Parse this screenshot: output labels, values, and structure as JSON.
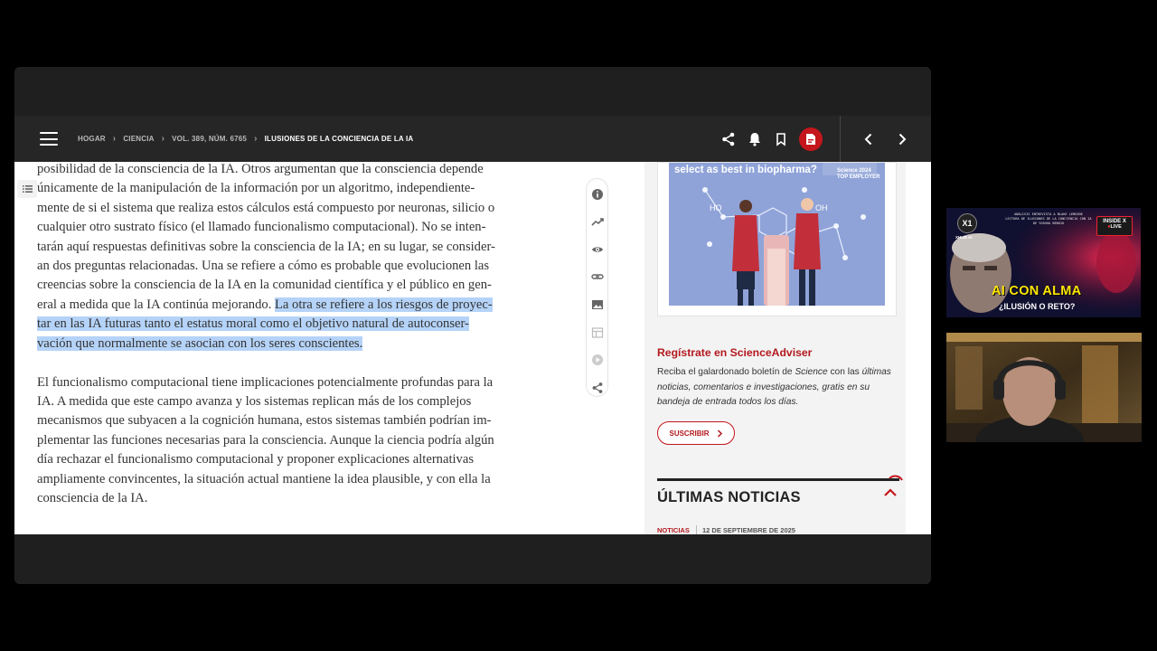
{
  "breadcrumb": {
    "items": [
      "HOGAR",
      "CIENCIA",
      "VOL. 389, NÚM. 6765"
    ],
    "current": "ILUSIONES DE LA CONCIENCIA DE LA IA"
  },
  "header_icons": [
    "share-icon",
    "bell-icon",
    "bookmark-icon",
    "pdf-icon",
    "chevron-left-icon",
    "chevron-right-icon"
  ],
  "article": {
    "p1_lines": [
      "posibilidad de la consciencia de la IA. Otros argumentan que la consciencia depende",
      "únicamente de la manipulación de la información por un algoritmo, independiente-",
      "mente de si el sistema que realiza estos cálculos está compuesto por neuronas, silicio o",
      "cualquier otro sustrato físico (el llamado funcionalismo computacional). No se inten-",
      "tarán aquí respuestas definitivas sobre la consciencia de la IA; en su lugar, se consider-",
      "an dos preguntas relacionadas. Una se refiere a cómo es probable que evolucionen las",
      "creencias sobre la consciencia de la IA en la comunidad científica y el público en gen-"
    ],
    "p1_line8_plain": "eral a medida que la IA continúa mejorando. ",
    "p1_line8_hl": "La otra se refiere a los riesgos de proyec-",
    "p1_hl_line9": "tar en las IA futuras tanto el estatus moral como el objetivo natural de autoconser-",
    "p1_hl_line10": "vación que normalmente se asocian con los seres conscientes.",
    "p2_lines": [
      "El funcionalismo computacional tiene implicaciones potencialmente profundas para la",
      "IA. A medida que este campo avanza y los sistemas replican más de los complejos",
      "mecanismos que subyacen a la cognición humana, estos sistemas también podrían im-",
      "plementar las funciones necesarias para la consciencia. Aunque la ciencia podría algún",
      "día rechazar el funcionalismo computacional y proponer explicaciones alternativas",
      "ampliamente convincentes, la situación actual mantiene la idea plausible, y con ella la",
      "consciencia de la IA."
    ]
  },
  "tool_rail": [
    "info-icon",
    "trending-icon",
    "eye-icon",
    "link-icon",
    "image-icon",
    "table-icon",
    "play-icon",
    "share-icon"
  ],
  "ad": {
    "tagline": "select as best in biopharma?",
    "brand_line1": "Science 2024",
    "brand_line2": "TOP EMPLOYER",
    "molecule_labels": [
      "HO",
      "OH"
    ]
  },
  "science_adviser": {
    "title": "Regístrate en ScienceAdviser",
    "desc_before": "Reciba el galardonado boletín de ",
    "desc_em": "Science",
    "desc_after": " con las ",
    "desc_em2": "últimas noticias, comentarios e investigaciones, gratis en su bandeja de entrada todos los días.",
    "button": "SUSCRIBIR"
  },
  "latest_news": {
    "title": "ÚLTIMAS NOTICIAS",
    "tag": "NOTICIAS",
    "date": "12 DE SEPTIEMBRE DE 2025"
  },
  "thumbnail": {
    "logo": "X1",
    "logo_sub": "XHUB AI",
    "top_line1": "ANÁLISIS ENTREVISTA A BLAKE LEMOINE",
    "top_line2": "LECTURA DE ILUSIONES DE LA CONCIENCIA CON IA",
    "top_line3": "DE YOSHUA BENGIO",
    "badge": "INSIDE X",
    "live": "LIVE",
    "title": "AI CON ALMA",
    "subtitle": "¿ILUSIÓN O RETO?"
  },
  "colors": {
    "accent_red": "#c4161c",
    "header_bg": "#262626",
    "highlight": "#b5d3f8",
    "thumb_yellow": "#ffe600"
  }
}
